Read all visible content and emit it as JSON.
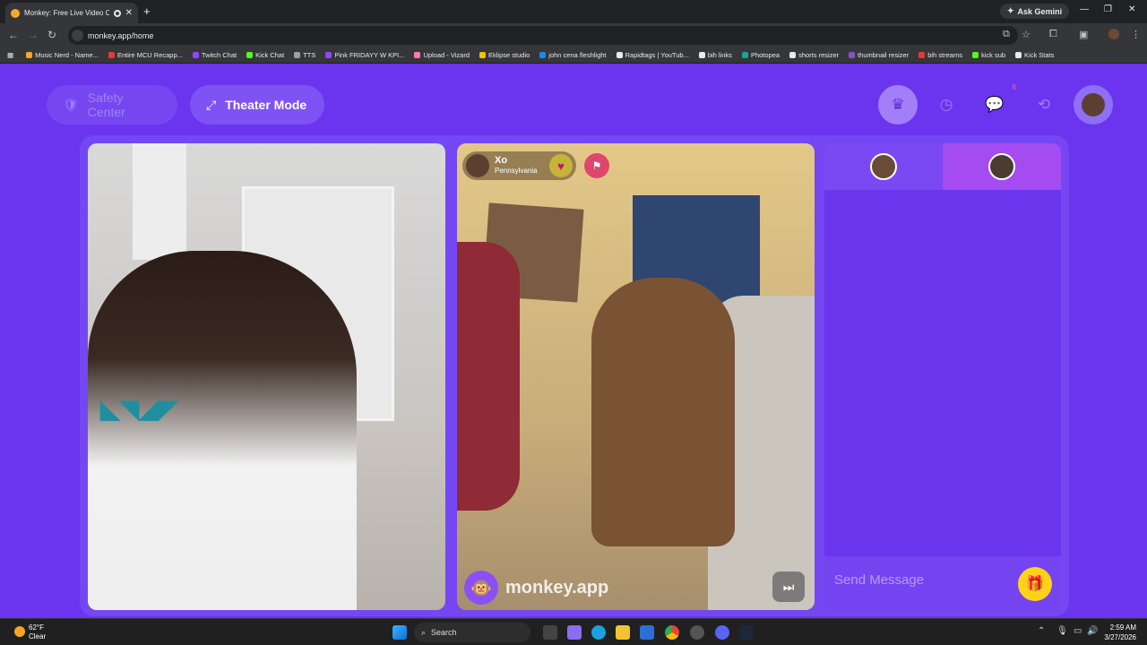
{
  "browser": {
    "tab_title": "Monkey: Free Live Video Ch",
    "new_tab": "+",
    "ask_gemini": "Ask Gemini",
    "url": "monkey.app/home",
    "bookmarks": [
      {
        "label": "Music Nerd - Name...",
        "color": "#f5a623"
      },
      {
        "label": "Entire MCU Recapp...",
        "color": "#e53935"
      },
      {
        "label": "Twitch Chat",
        "color": "#9146ff"
      },
      {
        "label": "Kick Chat",
        "color": "#53fc18"
      },
      {
        "label": "TTS",
        "color": "#9e9e9e"
      },
      {
        "label": "Pink FRIDAYY W KPI...",
        "color": "#9146ff"
      },
      {
        "label": "Upload - Vizard",
        "color": "#ff7ab6"
      },
      {
        "label": "Eklipse studio",
        "color": "#f5c400"
      },
      {
        "label": "john cena fleshlight",
        "color": "#1e88e5"
      },
      {
        "label": "Rapidtags | YouTub...",
        "color": "#e8eaed"
      },
      {
        "label": "bih links",
        "color": "#e8eaed"
      },
      {
        "label": "Photopea",
        "color": "#18a497"
      },
      {
        "label": "shorts resizer",
        "color": "#e8eaed"
      },
      {
        "label": "thumbnail resizer",
        "color": "#7e57c2"
      },
      {
        "label": "bih streams",
        "color": "#e53935"
      },
      {
        "label": "kick sub",
        "color": "#53fc18"
      },
      {
        "label": "Kick Stats",
        "color": "#e8eaed"
      }
    ]
  },
  "app": {
    "safety_center": "Safety Center",
    "theater_mode": "Theater Mode",
    "notification_count": "6",
    "remote_user": {
      "name": "Xo",
      "location": "Pennsylvania"
    },
    "watermark": "monkey.app",
    "send_placeholder": "Send Message"
  },
  "taskbar": {
    "temperature": "62°F",
    "weather": "Clear",
    "search": "Search",
    "time": "2:59 AM",
    "date": "3/27/2026"
  }
}
